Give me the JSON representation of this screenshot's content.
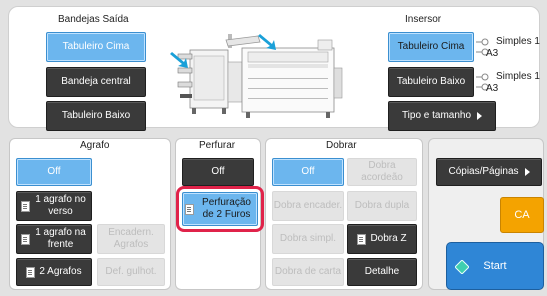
{
  "top": {
    "output_trays_title": "Bandejas Saída",
    "output_trays": [
      "Tabuleiro Cima",
      "Bandeja central",
      "Tabuleiro Baixo"
    ],
    "inserter_title": "Insersor",
    "inserter_trays": [
      "Tabuleiro Cima",
      "Tabuleiro Baixo"
    ],
    "paper_type_1": "Simples 1",
    "paper_size_1": "A3",
    "paper_type_2": "Simples 1",
    "paper_size_2": "A3",
    "type_size_button": "Tipo e tamanho"
  },
  "staple": {
    "title": "Agrafo",
    "off": "Off",
    "one_back": "1 agrafo no verso",
    "one_front": "1 agrafo na frente",
    "two": "2 Agrafos",
    "saddle": "Encadern. Agrafos",
    "gutter": "Def. gulhot."
  },
  "punch": {
    "title": "Perfurar",
    "off": "Off",
    "two_holes": "Perfuração de 2 Furos"
  },
  "fold": {
    "title": "Dobrar",
    "off": "Off",
    "accordion": "Dobra acordeão",
    "gate": "Dobra encader.",
    "double": "Dobra dupla",
    "single": "Dobra simpl.",
    "z": "Dobra Z",
    "letter": "Dobra de carta",
    "detail": "Detalhe"
  },
  "right": {
    "copies_pages": "Cópias/Páginas",
    "ca": "CA",
    "start": "Start"
  },
  "colors": {
    "selected_blue": "#6cb6ee",
    "dark_button": "#3a3a3a",
    "highlight_red": "#e0234a",
    "ca_orange": "#f4a300",
    "start_blue": "#2f86d6"
  }
}
